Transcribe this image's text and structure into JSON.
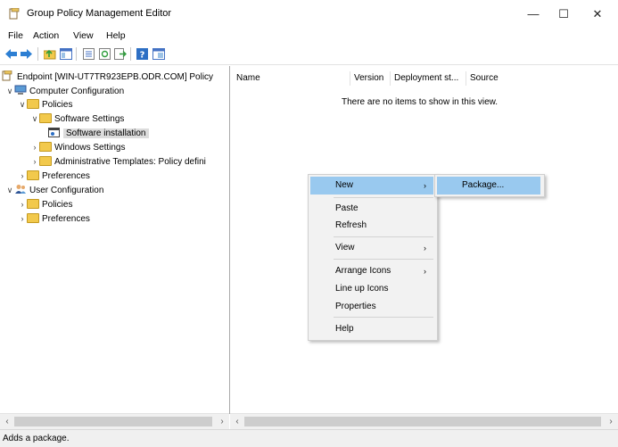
{
  "window": {
    "title": "Group Policy Management Editor",
    "minimize": "—",
    "maximize": "☐",
    "close": "✕"
  },
  "menu": [
    "File",
    "Action",
    "View",
    "Help"
  ],
  "toolbar": {
    "buttons": [
      "back-icon",
      "forward-icon",
      "up-folder-icon",
      "show-hide-tree-icon",
      "list-icon",
      "refresh-icon",
      "export-list-icon",
      "help-icon",
      "console-view-icon"
    ]
  },
  "tree": {
    "root": "Endpoint [WIN-UT7TR923EPB.ODR.COM] Policy",
    "computer_config": "Computer Configuration",
    "policies": "Policies",
    "software_settings": "Software Settings",
    "software_installation": "Software installation",
    "windows_settings": "Windows Settings",
    "admin_templates": "Administrative Templates: Policy defini",
    "preferences": "Preferences",
    "user_config": "User Configuration",
    "user_policies": "Policies",
    "user_preferences": "Preferences"
  },
  "list": {
    "columns": [
      "Name",
      "Version",
      "Deployment st...",
      "Source"
    ],
    "empty_message": "There are no items to show in this view."
  },
  "context_menu": {
    "items": [
      "New",
      "Paste",
      "Refresh",
      "View",
      "Arrange Icons",
      "Line up Icons",
      "Properties",
      "Help"
    ],
    "submenu": [
      "Package..."
    ]
  },
  "status": {
    "text": "Adds a package."
  },
  "colors": {
    "highlight": "#99c9ef",
    "menu_bg": "#f2f2f2",
    "folder": "#f2c94c"
  }
}
